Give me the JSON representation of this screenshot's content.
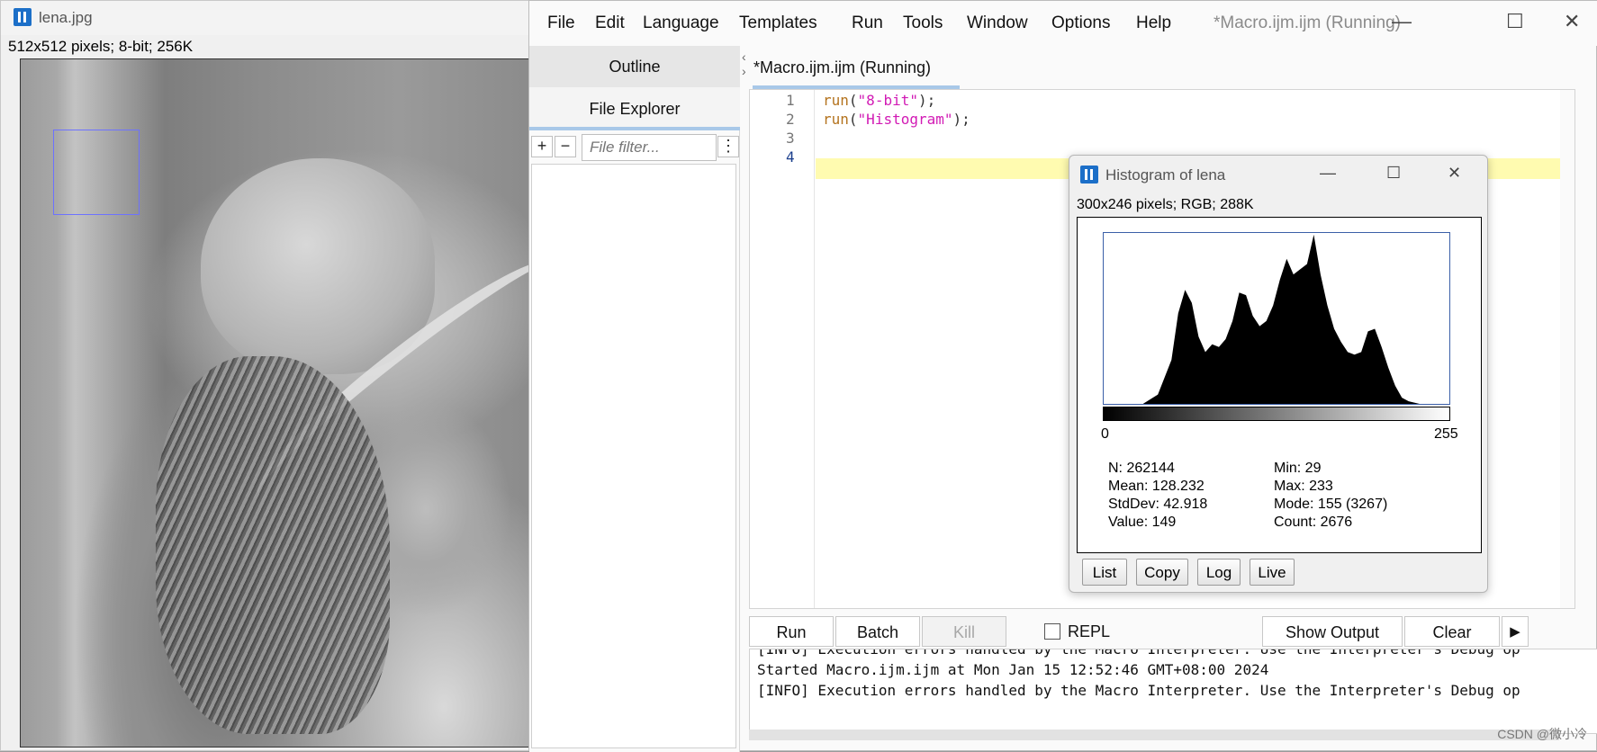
{
  "lena": {
    "title": "lena.jpg",
    "info": "512x512 pixels; 8-bit; 256K"
  },
  "editor": {
    "menu": [
      "File",
      "Edit",
      "Language",
      "Templates",
      "Run",
      "Tools",
      "Window",
      "Options",
      "Help"
    ],
    "title": "*Macro.ijm.ijm (Running)",
    "controls": {
      "minimize": "—",
      "maximize": "☐",
      "close": "✕"
    },
    "left_tabs": {
      "outline": "Outline",
      "explorer": "File Explorer"
    },
    "file_tools": {
      "add": "+",
      "remove": "−",
      "filter_placeholder": "File filter...",
      "more": "⋮"
    },
    "doc_tab": "*Macro.ijm.ijm (Running)",
    "line_numbers": [
      "1",
      "2",
      "3",
      "4"
    ],
    "code": [
      {
        "fn": "run",
        "open": "(",
        "arg": "\"8-bit\"",
        "close": ");"
      },
      {
        "fn": "run",
        "open": "(",
        "arg": "\"Histogram\"",
        "close": ");"
      }
    ],
    "buttons": {
      "run": "Run",
      "batch": "Batch",
      "kill": "Kill",
      "repl": "REPL",
      "show_output": "Show Output",
      "clear": "Clear",
      "more": "▶"
    },
    "console": [
      "[INFO] Execution errors handled by the Macro Interpreter. Use the Interpreter's Debug op",
      "Started Macro.ijm.ijm at Mon Jan 15 12:52:46 GMT+08:00 2024",
      "[INFO] Execution errors handled by the Macro Interpreter. Use the Interpreter's Debug op"
    ],
    "watermark": "CSDN @微小冷"
  },
  "histogram": {
    "title": "Histogram of lena",
    "info": "300x246 pixels; RGB; 288K",
    "axis_min": "0",
    "axis_max": "255",
    "stats": {
      "n": "N: 262144",
      "mean": "Mean: 128.232",
      "stddev": "StdDev: 42.918",
      "value": "Value: 149",
      "min": "Min: 29",
      "max": "Max: 233",
      "mode": "Mode: 155 (3267)",
      "count": "Count: 2676"
    },
    "buttons": {
      "list": "List",
      "copy": "Copy",
      "log": "Log",
      "live": "Live"
    }
  },
  "chart_data": {
    "type": "area",
    "xlim": [
      0,
      255
    ],
    "fill": "#000000",
    "x": [
      0,
      29,
      40,
      50,
      55,
      60,
      65,
      70,
      75,
      80,
      85,
      90,
      95,
      100,
      105,
      110,
      115,
      120,
      125,
      130,
      135,
      140,
      145,
      150,
      155,
      160,
      165,
      170,
      175,
      180,
      185,
      190,
      195,
      200,
      205,
      210,
      215,
      220,
      225,
      233,
      255
    ],
    "y": [
      0,
      0,
      180,
      850,
      1750,
      2200,
      1950,
      1300,
      1000,
      1150,
      1100,
      1250,
      1600,
      2150,
      2100,
      1700,
      1500,
      1600,
      1900,
      2400,
      2800,
      2500,
      2600,
      2700,
      3267,
      2500,
      1900,
      1450,
      1200,
      1000,
      950,
      1000,
      1400,
      1450,
      1100,
      700,
      350,
      120,
      50,
      0,
      0
    ],
    "ylim": [
      0,
      3300
    ]
  }
}
